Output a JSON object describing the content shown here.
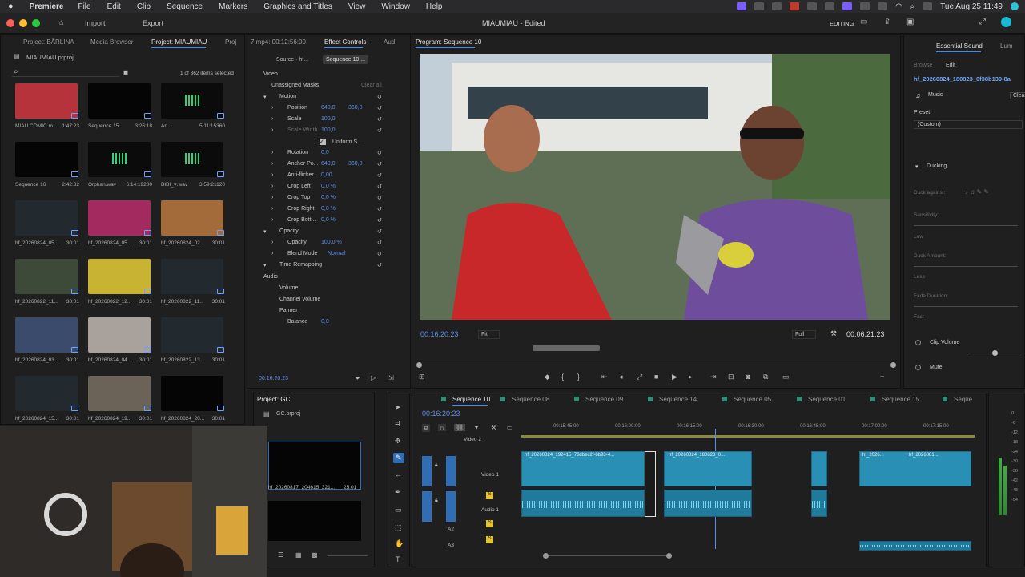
{
  "menubar": {
    "app": "Premiere",
    "items": [
      "File",
      "Edit",
      "Clip",
      "Sequence",
      "Markers",
      "Graphics and Titles",
      "View",
      "Window",
      "Help"
    ],
    "datetime": "Tue Aug 25  11:49"
  },
  "header": {
    "import": "Import",
    "export": "Export",
    "title": "MIAUMIAU - Edited",
    "workspace": "EDITING"
  },
  "project": {
    "tabs": [
      "Project: BĂRLINA",
      "Media Browser",
      "Project: MIAUMIAU",
      "Proj"
    ],
    "file": "MIAUMIAU.prproj",
    "selection": "1 of 362 items selected",
    "items": [
      {
        "name": "MIAU COMIC.m...",
        "dur": "1:47:23",
        "kind": "red"
      },
      {
        "name": "Sequence 15",
        "dur": "3:26:18",
        "kind": "black"
      },
      {
        "name": "An...",
        "dur": "5:11:15360",
        "kind": "audio"
      },
      {
        "name": "Sequence 16",
        "dur": "2:42:32",
        "kind": "black"
      },
      {
        "name": "Orphan.wav",
        "dur": "6:14:19200",
        "kind": "audio"
      },
      {
        "name": "BIBI_♥.wav",
        "dur": "3:59:21120",
        "kind": "audio"
      },
      {
        "name": "hf_20260824_05...",
        "dur": "30:01",
        "kind": "dark"
      },
      {
        "name": "hf_20260824_05...",
        "dur": "30:01",
        "kind": "pink"
      },
      {
        "name": "hf_20260824_02...",
        "dur": "30:01",
        "kind": "orange"
      },
      {
        "name": "hf_20260822_11...",
        "dur": "30:01",
        "kind": "green"
      },
      {
        "name": "hf_20260822_12...",
        "dur": "30:01",
        "kind": "yellow"
      },
      {
        "name": "hf_20260822_11...",
        "dur": "30:01",
        "kind": "dark"
      },
      {
        "name": "hf_20260824_03...",
        "dur": "30:01",
        "kind": "blue"
      },
      {
        "name": "hf_20260824_04...",
        "dur": "30:01",
        "kind": "light"
      },
      {
        "name": "hf_20260822_13...",
        "dur": "30:01",
        "kind": "dark"
      },
      {
        "name": "hf_20260824_15...",
        "dur": "30:01",
        "kind": "dark"
      },
      {
        "name": "hf_20260824_19...",
        "dur": "30:01",
        "kind": "gray"
      },
      {
        "name": "hf_20260824_20...",
        "dur": "30:01",
        "kind": "black"
      }
    ]
  },
  "effects": {
    "tabs": [
      "7.mp4: 00:12:56:00",
      "Effect Controls",
      "Aud"
    ],
    "source": "Source · hf...",
    "sequence": "Sequence 10 ...",
    "video": "Video",
    "masks": "Unassigned Masks",
    "clear_all": "Clear all",
    "rows": [
      {
        "label": "Motion",
        "v1": "",
        "v2": ""
      },
      {
        "label": "Position",
        "v1": "640,0",
        "v2": "360,0"
      },
      {
        "label": "Scale",
        "v1": "100,0",
        "v2": ""
      },
      {
        "label": "Scale Width",
        "v1": "100,0",
        "v2": ""
      },
      {
        "label": "Rotation",
        "v1": "0,0",
        "v2": ""
      },
      {
        "label": "Anchor Po...",
        "v1": "640,0",
        "v2": "360,0"
      },
      {
        "label": "Anti-flicker...",
        "v1": "0,00",
        "v2": ""
      },
      {
        "label": "Crop Left",
        "v1": "0,0 %",
        "v2": ""
      },
      {
        "label": "Crop Top",
        "v1": "0,0 %",
        "v2": ""
      },
      {
        "label": "Crop Right",
        "v1": "0,0 %",
        "v2": ""
      },
      {
        "label": "Crop Bott...",
        "v1": "0,0 %",
        "v2": ""
      },
      {
        "label": "Opacity",
        "v1": "",
        "v2": ""
      },
      {
        "label": "Opacity",
        "v1": "100,0 %",
        "v2": ""
      },
      {
        "label": "Blend Mode",
        "v1": "Normal",
        "v2": ""
      },
      {
        "label": "Time Remapping",
        "v1": "",
        "v2": ""
      }
    ],
    "uniform": "Uniform S...",
    "audio": "Audio",
    "volume": "Volume",
    "channel_volume": "Channel Volume",
    "panner": "Panner",
    "balance": "Balance",
    "balance_val": "0,0",
    "timecode": "00:16:20:23"
  },
  "program": {
    "title": "Program: Sequence 10",
    "timecode": "00:16:20:23",
    "fit": "Fit",
    "full": "Full",
    "duration": "00:06:21:23"
  },
  "essential": {
    "tab": "Essential Sound",
    "lum": "Lum",
    "browse": "Browse",
    "edit": "Edit",
    "clip": "hf_20260824_180823_0f38b139-8a",
    "music": "Music",
    "clear": "Clear",
    "preset_label": "Preset:",
    "preset": "(Custom)",
    "ducking": "Ducking",
    "duck_against": "Duck against:",
    "sensitivity": "Sensitivity:",
    "low": "Low",
    "duck_amount": "Duck Amount:",
    "less": "Less",
    "fade": "Fade Duration:",
    "fast": "Fast",
    "clip_volume": "Clip Volume",
    "mute": "Mute"
  },
  "project2": {
    "title": "Project: GC",
    "file": "GC.prproj",
    "clip": "hf_20260817_204615_321...",
    "dur": "25:01"
  },
  "timeline": {
    "tabs": [
      "Sequence 10",
      "Sequence 08",
      "Sequence 09",
      "Sequence 14",
      "Sequence 05",
      "Sequence 01",
      "Sequence 15",
      "Seque"
    ],
    "timecode": "00:16:20:23",
    "ruler": [
      "00:15:45:00",
      "00:16:00:00",
      "00:16:15:00",
      "00:16:30:00",
      "00:16:45:00",
      "00:17:00:00",
      "00:17:15:00"
    ],
    "tracks": {
      "v2": "Video 2",
      "v1": "Video 1",
      "a1": "Audio 1",
      "a2": "A2",
      "a3": "A3"
    },
    "clips": [
      "hf_20260824_192415_78dbec2f-6b93-4...",
      "hf_20260824_180823_0...",
      "hf_2026...",
      "hf_2026081..."
    ],
    "meter": [
      "0",
      "-6",
      "-12",
      "-18",
      "-24",
      "-30",
      "-36",
      "-42",
      "-48",
      "-54"
    ]
  }
}
